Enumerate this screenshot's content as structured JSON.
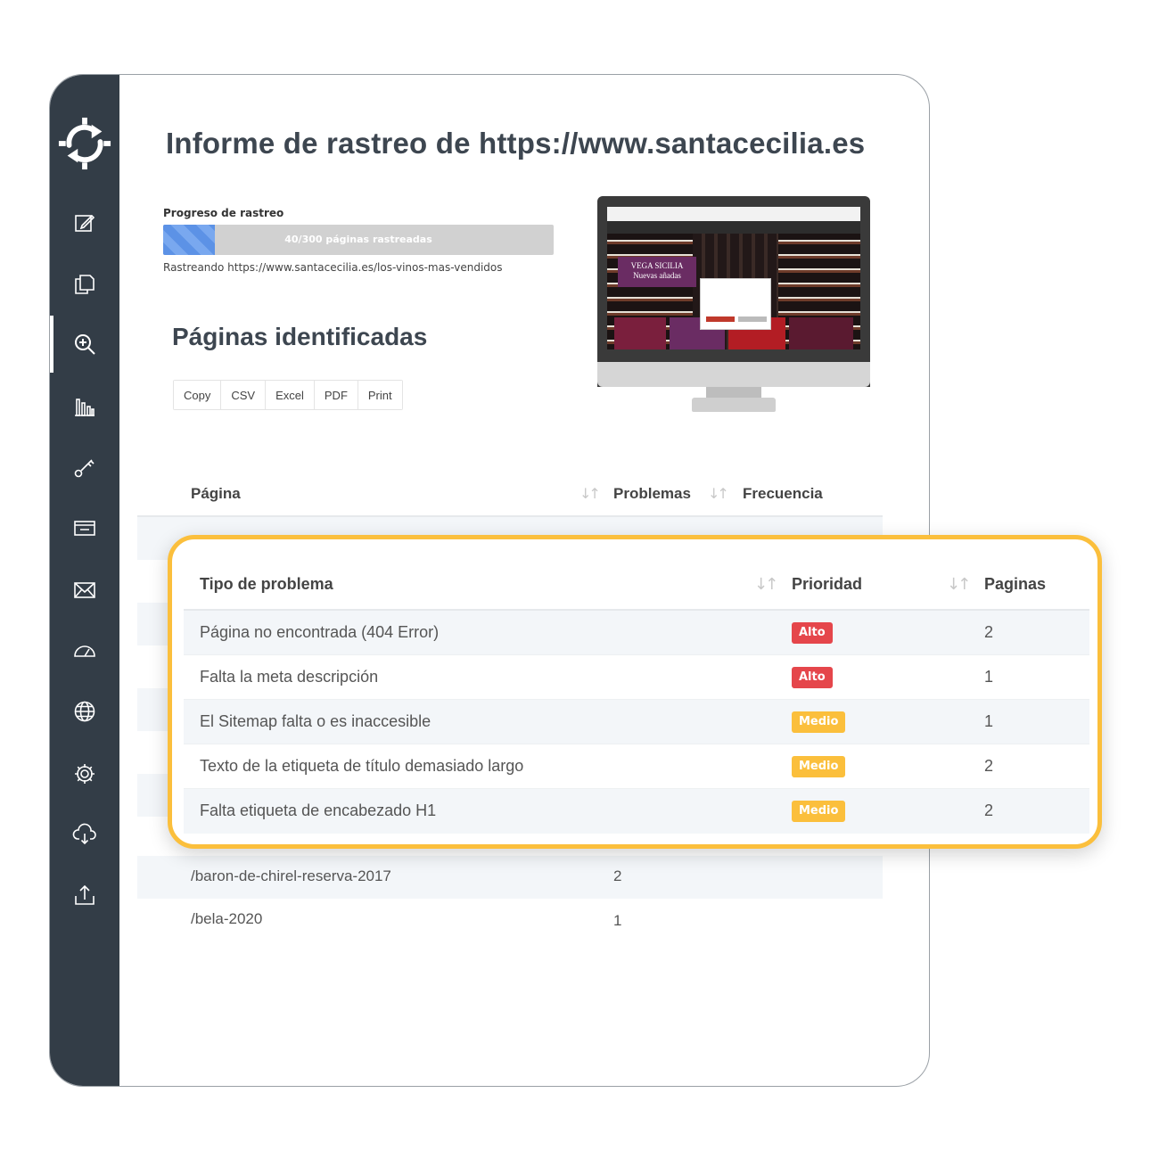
{
  "report": {
    "title": "Informe de rastreo de https://www.santacecilia.es",
    "progress_label": "Progreso de rastreo",
    "progress_text": "40/300 páginas rastreadas",
    "progress_fraction": 0.133,
    "crawl_url": "Rastreando https://www.santacecilia.es/los-vinos-mas-vendidos"
  },
  "sidebar": {
    "items": [
      {
        "icon": "edit-icon"
      },
      {
        "icon": "documents-icon"
      },
      {
        "icon": "search-zoom-icon",
        "active": true
      },
      {
        "icon": "bar-chart-icon"
      },
      {
        "icon": "key-icon"
      },
      {
        "icon": "card-icon"
      },
      {
        "icon": "mail-icon"
      },
      {
        "icon": "gauge-icon"
      },
      {
        "icon": "globe-icon"
      },
      {
        "icon": "gear-icon"
      },
      {
        "icon": "cloud-download-icon"
      },
      {
        "icon": "upload-icon"
      }
    ]
  },
  "monitor": {
    "banner_line1": "VEGA SICILIA",
    "banner_line2": "Nuevas añadas"
  },
  "pages_section": {
    "title": "Páginas identificadas",
    "export_buttons": [
      "Copy",
      "CSV",
      "Excel",
      "PDF",
      "Print"
    ],
    "columns": [
      "Página",
      "Problemas",
      "Frecuencia"
    ],
    "visible_rows": [
      {
        "page": "/baron-de-chirel-reserva-2017",
        "problems": "2"
      },
      {
        "page": "/bela-2020",
        "problems": "1"
      }
    ]
  },
  "issues": {
    "columns": [
      "Tipo de problema",
      "Prioridad",
      "Paginas"
    ],
    "rows": [
      {
        "type": "Página no encontrada (404 Error)",
        "priority": "Alto",
        "pages": "2"
      },
      {
        "type": "Falta la meta descripción",
        "priority": "Alto",
        "pages": "1"
      },
      {
        "type": "El Sitemap falta o es inaccesible",
        "priority": "Medio",
        "pages": "1"
      },
      {
        "type": "Texto de la etiqueta de título demasiado largo",
        "priority": "Medio",
        "pages": "2"
      },
      {
        "type": "Falta etiqueta de encabezado H1",
        "priority": "Medio",
        "pages": "2"
      }
    ]
  },
  "colors": {
    "sidebar": "#333d47",
    "accent_border": "#fbbf3c",
    "priority_alto": "#e5464b",
    "priority_medio": "#fbbf3c",
    "progress_fill": "#5c92e6"
  }
}
